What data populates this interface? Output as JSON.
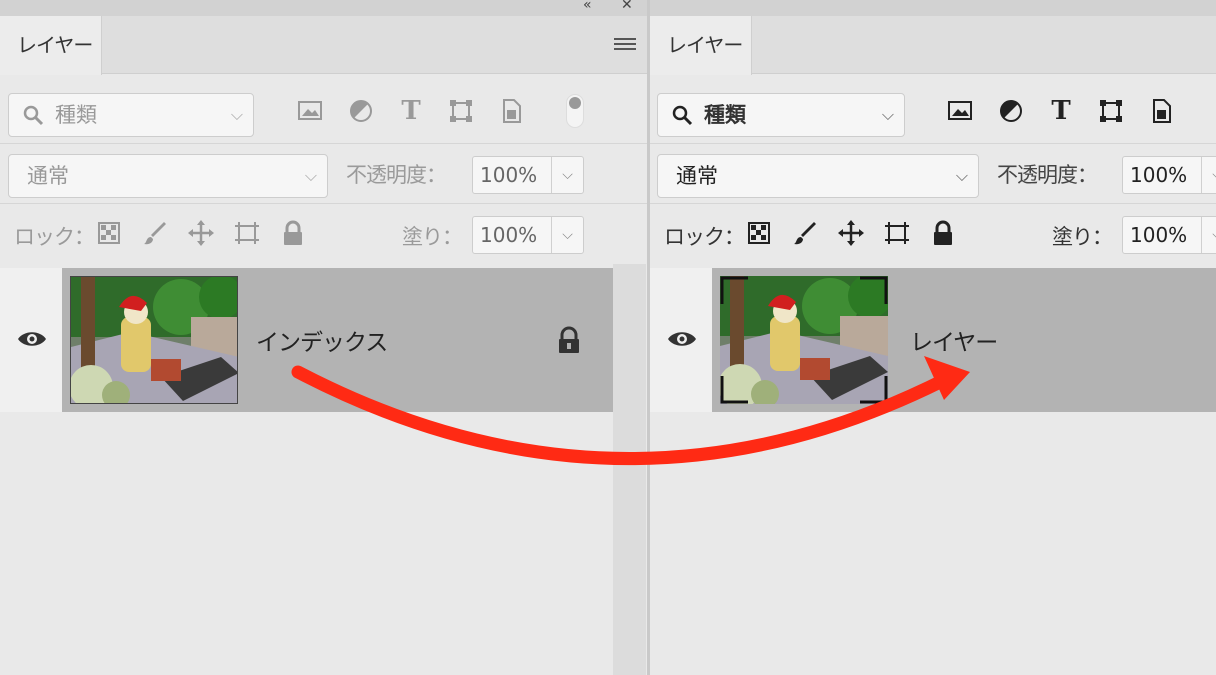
{
  "panels": [
    {
      "tab_label": "レイヤー",
      "filter": {
        "value": "種類"
      },
      "blend": {
        "value": "通常"
      },
      "opacity": {
        "label": "不透明度：",
        "value": "100%"
      },
      "lock": {
        "label": "ロック："
      },
      "fill": {
        "label": "塗り：",
        "value": "100%"
      },
      "layer": {
        "name": "インデックス",
        "locked": true,
        "selected": true
      }
    },
    {
      "tab_label": "レイヤー",
      "filter": {
        "value": "種類"
      },
      "blend": {
        "value": "通常"
      },
      "opacity": {
        "label": "不透明度：",
        "value": "100%"
      },
      "lock": {
        "label": "ロック："
      },
      "fill": {
        "label": "塗り：",
        "value": "100%"
      },
      "layer": {
        "name": "レイヤー",
        "locked": false,
        "selected": true
      }
    }
  ],
  "icons": {
    "filter_types": [
      "pixel-layer-icon",
      "adjustment-layer-icon",
      "type-layer-icon",
      "shape-layer-icon",
      "smart-object-icon"
    ],
    "lock_types": [
      "lock-transparent-pixels-icon",
      "lock-image-pixels-icon",
      "lock-position-icon",
      "lock-artboard-icon",
      "lock-all-icon"
    ]
  },
  "colors": {
    "arrow": "#ff2a14",
    "selected_layer": "#b3b3b3",
    "panel_bg": "#e9e9e9"
  }
}
